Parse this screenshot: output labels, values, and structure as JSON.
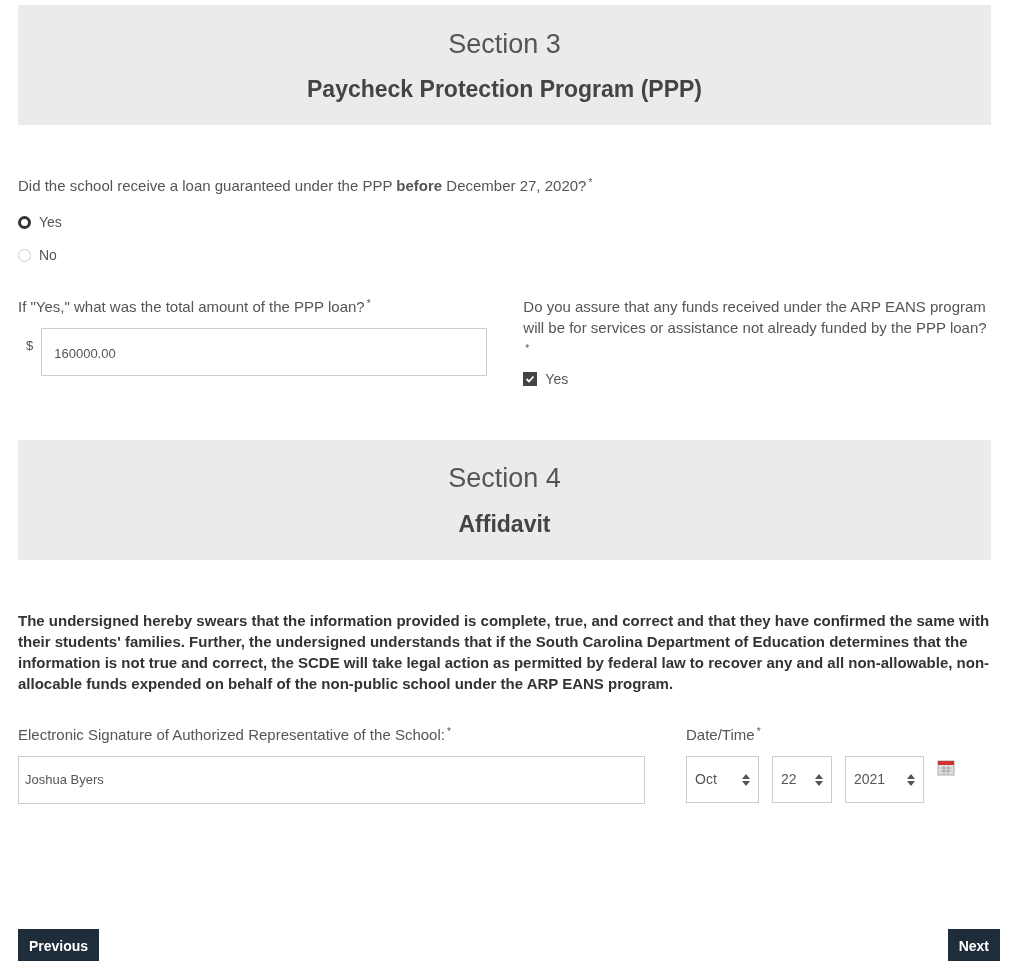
{
  "section3": {
    "number": "Section 3",
    "title": "Paycheck Protection Program (PPP)"
  },
  "ppp_question": {
    "label": "Did the school receive a loan guaranteed under the PPP **before** December 27, 2020?",
    "required": "*",
    "options": [
      {
        "label": "Yes",
        "selected": true
      },
      {
        "label": "No",
        "selected": false
      }
    ]
  },
  "loan_amount": {
    "label": "If \"Yes,\" what was the total amount of the PPP loan?",
    "required": "*",
    "prefix": "$",
    "value": "160000.00"
  },
  "assurance": {
    "label": "Do you assure that any funds received under the ARP EANS program will be for services or assistance not already funded by the PPP loan?",
    "required": "*",
    "option": {
      "label": "Yes",
      "checked": true
    }
  },
  "section4": {
    "number": "Section 4",
    "title": "Affidavit"
  },
  "affidavit_text": "The undersigned hereby swears that the information provided is complete, true, and correct and that they have confirmed the same with their students' families. Further, the undersigned understands that if the South Carolina Department of Education determines that the information is not true and correct, the SCDE will take legal action as permitted by federal law to recover any and all non-allowable, non-allocable funds expended on behalf of the non-public school under the ARP EANS program.",
  "signature": {
    "label": "Electronic Signature of Authorized Representative of the School:",
    "required": "*",
    "value": "Joshua Byers"
  },
  "date_time": {
    "label": "Date/Time",
    "required": "*",
    "month": "Oct",
    "day": "22",
    "year": "2021"
  },
  "buttons": {
    "previous": "Previous",
    "next": "Next"
  }
}
